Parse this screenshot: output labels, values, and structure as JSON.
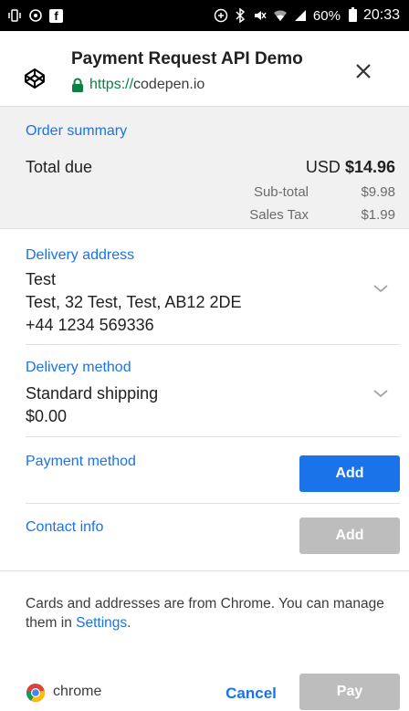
{
  "status_bar": {
    "time": "20:33",
    "battery": "60%",
    "left_icons": [
      "vibrate-icon",
      "sync-icon",
      "facebook-icon"
    ],
    "right_icons": [
      "data-saver-icon",
      "bluetooth-icon",
      "mute-icon",
      "wifi-icon",
      "signal-icon",
      "battery-icon"
    ]
  },
  "header": {
    "title": "Payment Request API Demo",
    "url_scheme": "https://",
    "url_host": "codepen.io",
    "close_icon": "close-icon",
    "logo_icon": "codepen-icon"
  },
  "order_summary": {
    "label": "Order summary",
    "total_label": "Total due",
    "currency": "USD",
    "total_amount": "$14.96",
    "line_items": [
      {
        "label": "Sub-total",
        "value": "$9.98"
      },
      {
        "label": "Sales Tax",
        "value": "$1.99"
      }
    ]
  },
  "delivery_address": {
    "label": "Delivery address",
    "name": "Test",
    "address": "Test, 32 Test, Test, AB12 2DE",
    "phone": "+44 1234 569336"
  },
  "delivery_method": {
    "label": "Delivery method",
    "name": "Standard shipping",
    "price": "$0.00"
  },
  "payment_method": {
    "label": "Payment method",
    "button": "Add"
  },
  "contact_info": {
    "label": "Contact info",
    "button": "Add"
  },
  "footer": {
    "note_prefix": "Cards and addresses are from Chrome. You can manage them in ",
    "settings_link": "Settings",
    "note_suffix": "."
  },
  "bottom_bar": {
    "brand": "chrome",
    "cancel": "Cancel",
    "pay": "Pay"
  },
  "colors": {
    "accent_blue": "#1a73e8",
    "secure_green": "#0b8043",
    "disabled_grey": "#bdbdbd",
    "summary_bg": "#f1f1f1"
  }
}
